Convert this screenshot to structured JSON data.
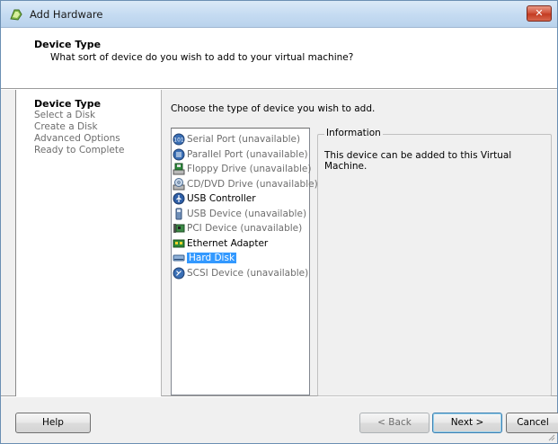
{
  "window": {
    "title": "Add Hardware",
    "close_label": "✕"
  },
  "header": {
    "title": "Device Type",
    "subtitle": "What sort of device do you wish to add to your virtual machine?"
  },
  "steps": [
    {
      "label": "Device Type",
      "active": true
    },
    {
      "label": "Select a Disk",
      "active": false
    },
    {
      "label": "Create a Disk",
      "active": false
    },
    {
      "label": "Advanced Options",
      "active": false
    },
    {
      "label": "Ready to Complete",
      "active": false
    }
  ],
  "main": {
    "instruction": "Choose the type of device you wish to add.",
    "devices": [
      {
        "label": "Serial Port (unavailable)",
        "icon": "serial-port-icon",
        "disabled": true,
        "selected": false
      },
      {
        "label": "Parallel Port (unavailable)",
        "icon": "parallel-port-icon",
        "disabled": true,
        "selected": false
      },
      {
        "label": "Floppy Drive (unavailable)",
        "icon": "floppy-drive-icon",
        "disabled": true,
        "selected": false
      },
      {
        "label": "CD/DVD Drive (unavailable)",
        "icon": "cd-dvd-drive-icon",
        "disabled": true,
        "selected": false
      },
      {
        "label": "USB Controller",
        "icon": "usb-controller-icon",
        "disabled": false,
        "selected": false
      },
      {
        "label": "USB Device (unavailable)",
        "icon": "usb-device-icon",
        "disabled": true,
        "selected": false
      },
      {
        "label": "PCI Device (unavailable)",
        "icon": "pci-device-icon",
        "disabled": true,
        "selected": false
      },
      {
        "label": "Ethernet Adapter",
        "icon": "ethernet-adapter-icon",
        "disabled": false,
        "selected": false
      },
      {
        "label": "Hard Disk",
        "icon": "hard-disk-icon",
        "disabled": false,
        "selected": true
      },
      {
        "label": "SCSI Device (unavailable)",
        "icon": "scsi-device-icon",
        "disabled": true,
        "selected": false
      }
    ],
    "info": {
      "legend": "Information",
      "text": "This device can be added to this Virtual Machine."
    }
  },
  "footer": {
    "help_label": "Help",
    "back_label": "< Back",
    "next_label": "Next >",
    "cancel_label": "Cancel"
  }
}
